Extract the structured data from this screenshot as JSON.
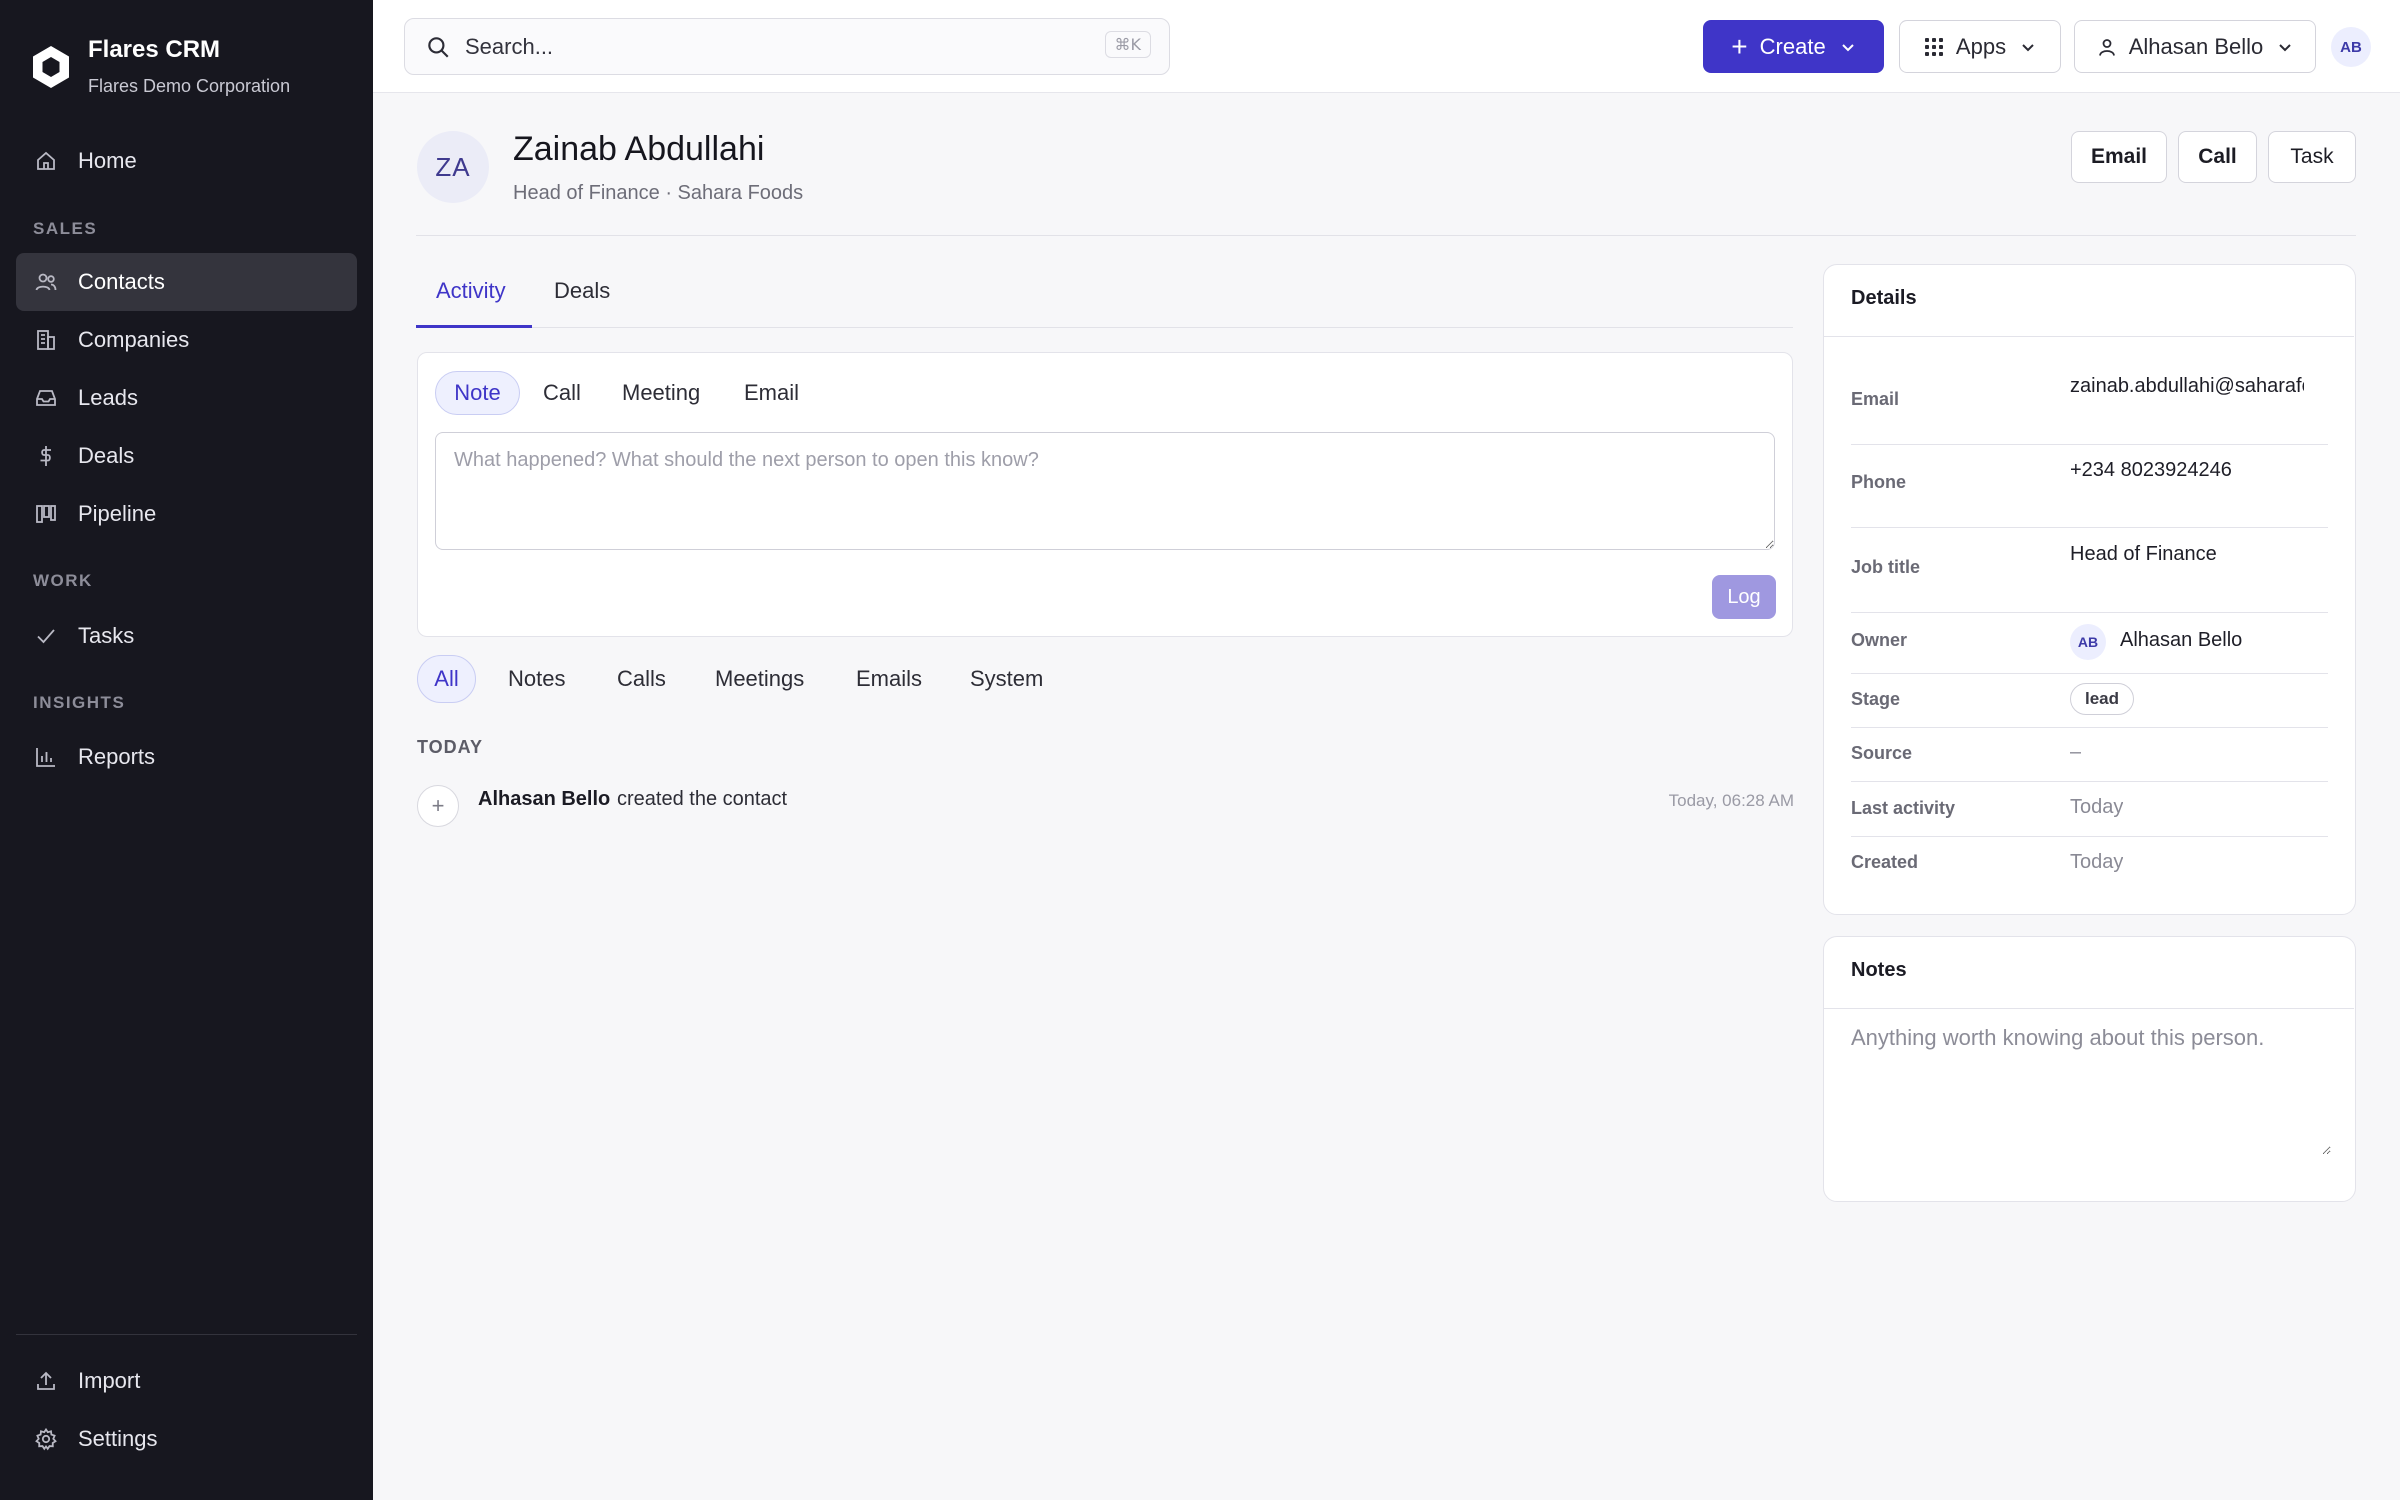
{
  "brand": {
    "name": "Flares CRM",
    "org": "Flares Demo Corporation"
  },
  "nav": {
    "home": "Home",
    "sales_section": "SALES",
    "contacts": "Contacts",
    "companies": "Companies",
    "leads": "Leads",
    "deals": "Deals",
    "pipeline": "Pipeline",
    "work_section": "WORK",
    "tasks": "Tasks",
    "insights_section": "INSIGHTS",
    "reports": "Reports",
    "import": "Import",
    "settings": "Settings"
  },
  "topbar": {
    "search_placeholder": "Search...",
    "search_shortcut": "⌘K",
    "create_label": "Create",
    "apps_label": "Apps",
    "user_label": "Alhasan Bello",
    "user_initials": "AB"
  },
  "contact": {
    "initials": "ZA",
    "name": "Zainab Abdullahi",
    "subtitle": "Head of Finance · Sahara Foods",
    "actions": {
      "email": "Email",
      "call": "Call",
      "task": "Task"
    }
  },
  "tabs": {
    "activity": "Activity",
    "deals": "Deals"
  },
  "composer": {
    "types": {
      "note": "Note",
      "call": "Call",
      "meeting": "Meeting",
      "email": "Email"
    },
    "placeholder": "What happened? What should the next person to open this know?",
    "log_label": "Log"
  },
  "filters": {
    "all": "All",
    "notes": "Notes",
    "calls": "Calls",
    "meetings": "Meetings",
    "emails": "Emails",
    "system": "System"
  },
  "timeline": {
    "group_label": "TODAY",
    "item": {
      "actor": "Alhasan Bello",
      "text": "created the contact",
      "time": "Today, 06:28 AM"
    }
  },
  "details": {
    "title": "Details",
    "email_label": "Email",
    "email_value": "zainab.abdullahi@saharafoods.ng",
    "phone_label": "Phone",
    "phone_value": "+234 8023924246",
    "job_label": "Job title",
    "job_value": "Head of Finance",
    "owner_label": "Owner",
    "owner_initials": "AB",
    "owner_value": "Alhasan Bello",
    "stage_label": "Stage",
    "stage_value": "lead",
    "source_label": "Source",
    "source_value": "–",
    "last_activity_label": "Last activity",
    "last_activity_value": "Today",
    "created_label": "Created",
    "created_value": "Today"
  },
  "notes": {
    "title": "Notes",
    "placeholder": "Anything worth knowing about this person."
  },
  "colors": {
    "accent": "#3f35c8",
    "sidebar": "#17171f",
    "log_disabled": "#9f98e0"
  }
}
